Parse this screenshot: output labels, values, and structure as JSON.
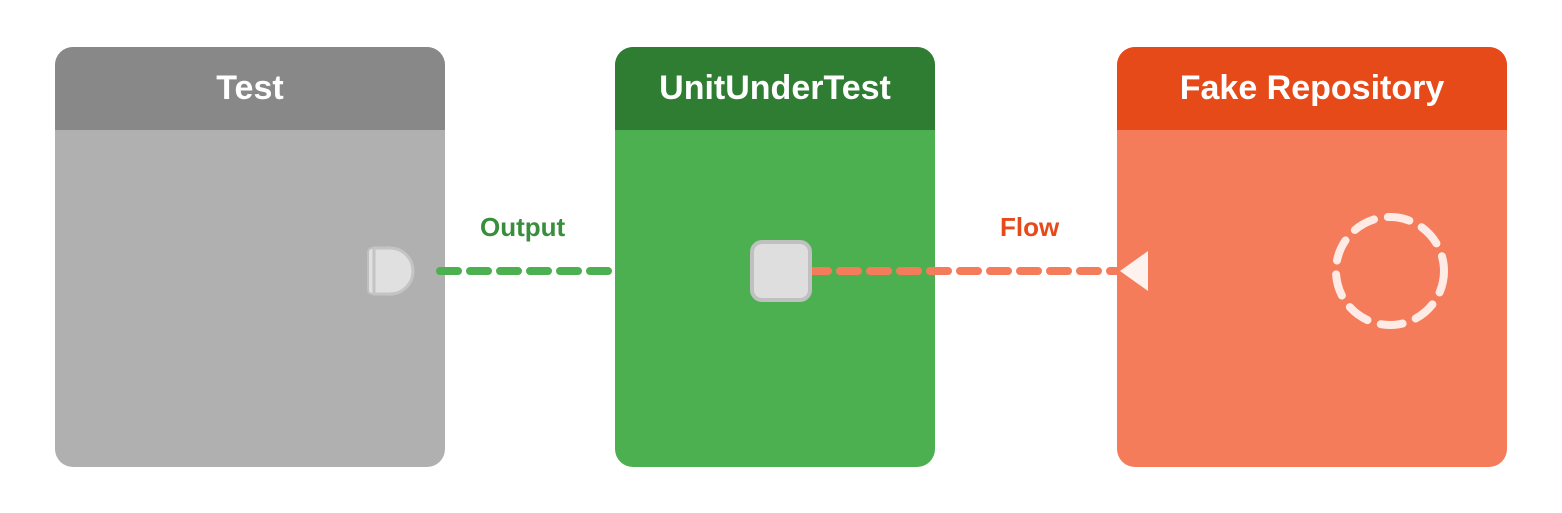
{
  "boxes": {
    "test": {
      "header": "Test",
      "bg": "#b0b0b0",
      "headerBg": "#888888"
    },
    "unit": {
      "header": "UnitUnderTest",
      "bg": "#4caf50",
      "headerBg": "#2e7d32"
    },
    "fake": {
      "header": "Fake Repository",
      "bg": "#f47c5a",
      "headerBg": "#e64a19"
    }
  },
  "labels": {
    "output": "Output",
    "flow": "Flow"
  }
}
